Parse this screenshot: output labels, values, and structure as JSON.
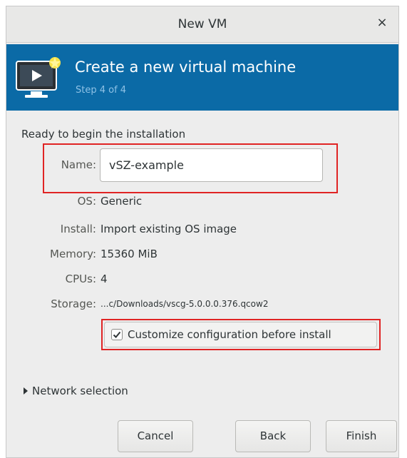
{
  "window": {
    "title": "New VM",
    "close_glyph": "×"
  },
  "banner": {
    "heading": "Create a new virtual machine",
    "step": "Step 4 of 4",
    "icon": "monitor-play-icon"
  },
  "summary": {
    "intro": "Ready to begin the installation",
    "name_label": "Name:",
    "name_value": "vSZ-example",
    "rows": [
      {
        "label": "OS:",
        "value": "Generic"
      },
      {
        "label": "Install:",
        "value": "Import existing OS image"
      },
      {
        "label": "Memory:",
        "value": "15360 MiB"
      },
      {
        "label": "CPUs:",
        "value": "4"
      },
      {
        "label": "Storage:",
        "value": "...c/Downloads/vscg-5.0.0.0.376.qcow2"
      }
    ]
  },
  "options": {
    "customize_label": "Customize configuration before install",
    "customize_checked": true,
    "network_label": "Network selection"
  },
  "buttons": {
    "cancel": "Cancel",
    "back": "Back",
    "finish": "Finish"
  },
  "colors": {
    "banner": "#0b6aa6",
    "highlight": "#e02424"
  }
}
